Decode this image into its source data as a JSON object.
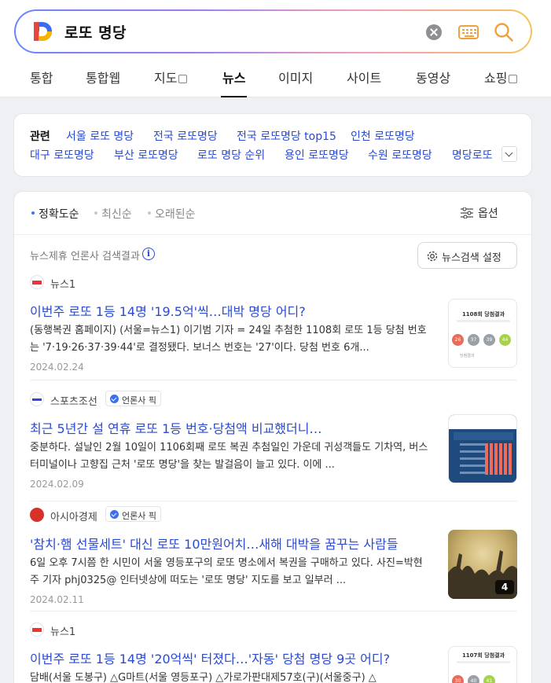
{
  "search": {
    "query": "로또 명당"
  },
  "tabs": [
    {
      "label": "통합"
    },
    {
      "label": "통합웹"
    },
    {
      "label": "지도"
    },
    {
      "label": "뉴스"
    },
    {
      "label": "이미지"
    },
    {
      "label": "사이트"
    },
    {
      "label": "동영상"
    },
    {
      "label": "쇼핑"
    }
  ],
  "related": {
    "title": "관련",
    "links": [
      "서울 로또 명당",
      "전국 로또명당",
      "전국 로또명당 top15",
      "인천 로또명당",
      "대구 로또명당",
      "부산 로또명당",
      "로또 명당 순위",
      "용인 로또명당",
      "수원 로또명당",
      "명당로또"
    ]
  },
  "sort": {
    "options": [
      "정확도순",
      "최신순",
      "오래된순"
    ],
    "options_label": "옵션"
  },
  "partner": {
    "label": "뉴스제휴 언론사 검색결과",
    "settings_label": "뉴스검색 설정"
  },
  "pick_label": "언론사 픽",
  "articles": [
    {
      "source": "뉴스1",
      "title": "이번주 로또 1등 14명 '19.5억'씩…대박 명당 어디?",
      "snippet": "(동행복권 홈페이지) (서울=뉴스1) 이기범 기자 = 24일 추첨한 1108회 로또 1등 당첨 번호는 '7·19·26·37·39·44'로 결정됐다. 보너스 번호는 '27'이다. 당첨 번호 6개...",
      "date": "2024.02.24",
      "thumb": {
        "heading": "1108회 당첨결과",
        "balls": [
          "26",
          "37",
          "39",
          "44"
        ],
        "foot": "당첨결과"
      }
    },
    {
      "source": "스포츠조선",
      "title": "최근 5년간 설 연휴 로또 1등 번호·당첨액 비교했더니…",
      "snippet": "중분하다. 설날인 2월 10일이 1106회째 로또 복권 추첨일인 가운데 귀성객들도 기차역, 버스터미널이나 고향집 근처 '로또 명당'을 찾는 발걸음이 늘고 있다. 이에 ...",
      "date": "2024.02.09"
    },
    {
      "source": "아시아경제",
      "title": "'참치·햄 선물세트' 대신 로또 10만원어치…새해 대박을 꿈꾸는 사람들",
      "snippet": "6일 오후 7시쯤 한 시민이 서울 영등포구의 로또 명소에서 복권을 구매하고 있다. 사진=박현주 기자 phj0325@ 인터넷상에 떠도는 '로또 명당' 지도를 보고 일부러 ...",
      "date": "2024.02.11",
      "thumb": {
        "count": "4"
      }
    },
    {
      "source": "뉴스1",
      "title": "이번주 로또 1등 14명 '20억씩' 터졌다…'자동' 당첨 명당 9곳 어디?",
      "snippet": "담배(서울 도봉구) △G마트(서울 영등포구) △가로가판대제57호(구)(서울중구) △",
      "thumb": {
        "heading": "1107회 당첨결과",
        "balls": [
          "30",
          "40",
          "41"
        ]
      }
    }
  ],
  "colors": {
    "link": "#2a4ad0",
    "accent_dot": "#2e7bf5",
    "search_icon": "#f0a040"
  }
}
